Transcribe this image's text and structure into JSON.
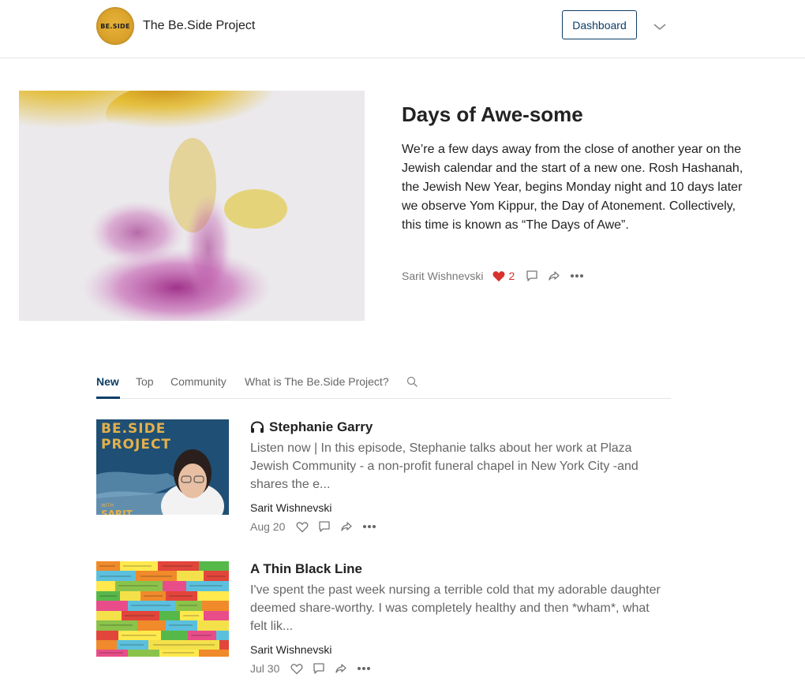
{
  "header": {
    "logo_text": "BE.SIDE",
    "site_title": "The Be.Side Project",
    "dashboard_label": "Dashboard",
    "menu_icon": "chevron-down-icon"
  },
  "featured": {
    "title": "Days of Awe-some",
    "excerpt": "We’re a few days away from the close of another year on the Jewish calendar and the start of a new one. Rosh Hashanah, the Jewish New Year, begins Monday night and 10 days later we observe Yom Kippur, the Day of Atonement. Collectively, this time is known as “The Days of Awe”.",
    "author": "Sarit Wishnevski",
    "likes": "2",
    "like_color": "#d9312c"
  },
  "tabs": [
    {
      "label": "New",
      "active": true
    },
    {
      "label": "Top",
      "active": false
    },
    {
      "label": "Community",
      "active": false
    },
    {
      "label": "What is The Be.Side Project?",
      "active": false
    }
  ],
  "posts": [
    {
      "title": "Stephanie Garry",
      "podcast": true,
      "excerpt": "Listen now | In this episode, Stephanie talks about her work at Plaza Jewish Community - a non-profit funeral chapel in New York City -and shares the e...",
      "author": "Sarit Wishnevski",
      "date": "Aug 20",
      "thumb_line1": "BE.SIDE",
      "thumb_line2": "PROJECT",
      "thumb_with": "WITH",
      "thumb_name": "SARIT"
    },
    {
      "title": "A Thin Black Line",
      "podcast": false,
      "excerpt": "I've spent the past week nursing a terrible cold that my adorable daughter deemed share-worthy. I was completely healthy and then *wham*, what felt lik...",
      "author": "Sarit Wishnevski",
      "date": "Jul 30"
    }
  ],
  "colors": {
    "accent": "#0b3d66",
    "logo_gold": "#d9a12a"
  }
}
